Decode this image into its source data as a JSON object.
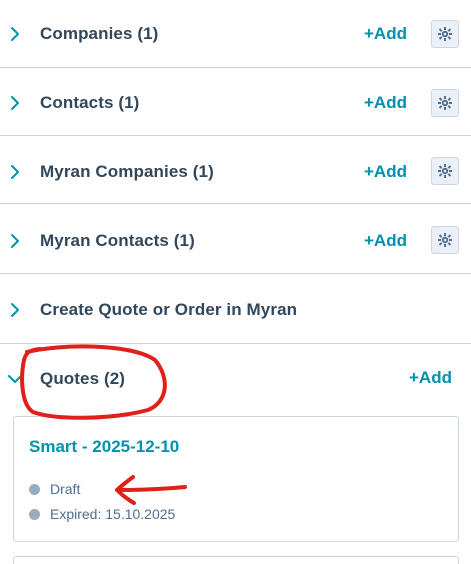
{
  "sections": [
    {
      "label": "Companies (1)",
      "add_label": "+Add",
      "has_gear": true
    },
    {
      "label": "Contacts (1)",
      "add_label": "+Add",
      "has_gear": true
    },
    {
      "label": "Myran Companies (1)",
      "add_label": "+Add",
      "has_gear": true
    },
    {
      "label": "Myran Contacts (1)",
      "add_label": "+Add",
      "has_gear": true
    },
    {
      "label": "Create Quote or Order in Myran"
    },
    {
      "label": "Quotes (2)",
      "add_label": "+Add",
      "expanded": true
    }
  ],
  "quote_card": {
    "title": "Smart - 2025-12-10",
    "status": "Draft",
    "expiry": "Expired: 15.10.2025"
  },
  "colors": {
    "accent": "#0091ae",
    "text": "#33475b",
    "muted": "#516f90",
    "border": "#cbd6e2",
    "annotation": "#e0201b"
  },
  "icons": {
    "collapsed": "chevron-right-icon",
    "expanded": "chevron-down-icon",
    "settings": "gear-icon"
  }
}
